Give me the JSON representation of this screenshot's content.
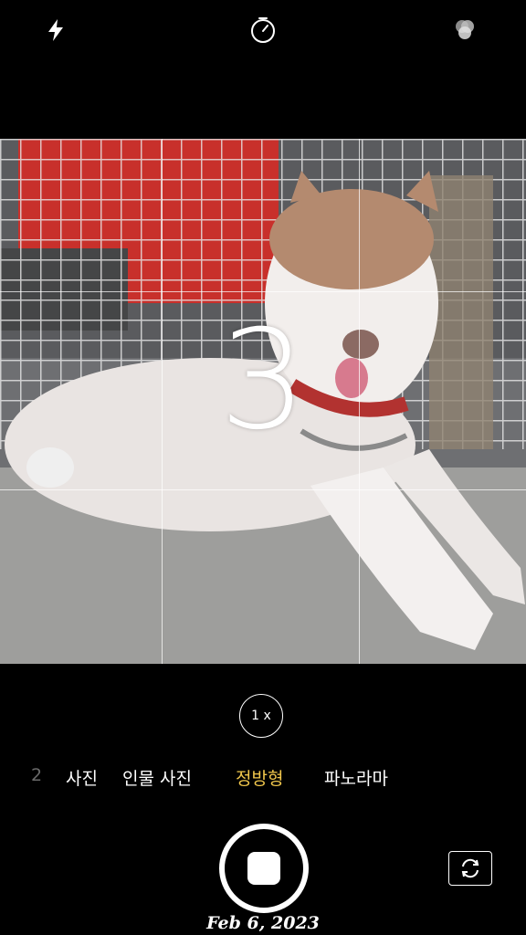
{
  "topbar": {
    "flash_icon": "flash-icon",
    "timer_icon": "timer-icon",
    "filters_icon": "filters-icon"
  },
  "viewfinder": {
    "countdown": "3",
    "grid": "on"
  },
  "zoom": {
    "label": "1 x"
  },
  "modes": {
    "items": [
      {
        "label": "2"
      },
      {
        "label": "사진"
      },
      {
        "label": "인물 사진"
      },
      {
        "label": "정방형"
      },
      {
        "label": "파노라마"
      }
    ],
    "active": "정방형"
  },
  "controls": {
    "shutter_icon": "stop-record-icon",
    "flip_icon": "flip-camera-icon"
  },
  "overlay": {
    "date": "Feb 6, 2023"
  },
  "colors": {
    "background": "#000000",
    "active_mode": "#f1c74c"
  }
}
